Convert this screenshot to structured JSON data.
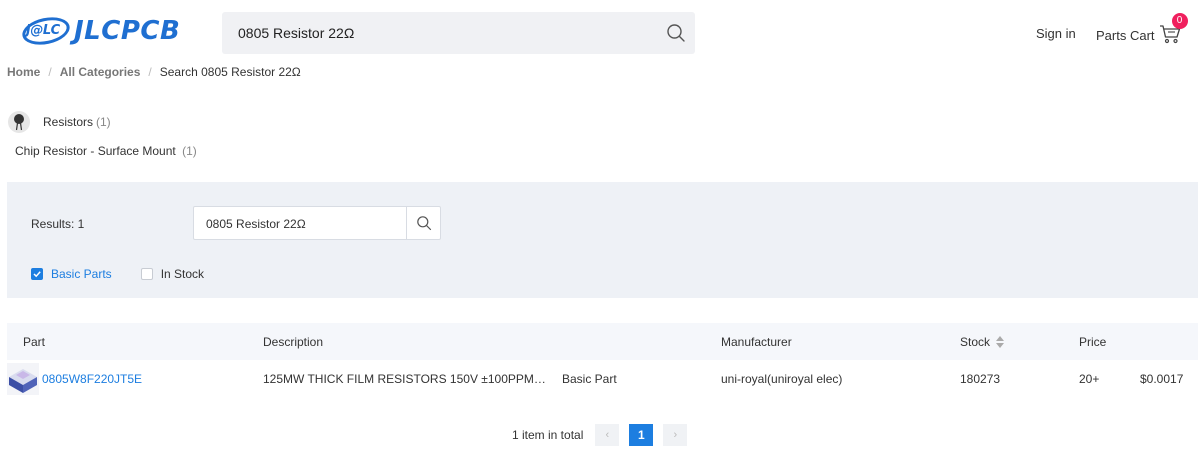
{
  "header": {
    "logo_badge": "J@LC",
    "logo_text": "JLCPCB",
    "search_value": "0805 Resistor 22Ω",
    "sign_in": "Sign in",
    "cart_label": "Parts Cart",
    "cart_count": "0"
  },
  "breadcrumb": {
    "home": "Home",
    "all_categories": "All Categories",
    "current": "Search 0805 Resistor 22Ω"
  },
  "categories": {
    "parent_name": "Resistors",
    "parent_count": "(1)",
    "child_name": "Chip Resistor - Surface Mount",
    "child_count": "(1)"
  },
  "filter": {
    "results_label": "Results: 1",
    "search_value": "0805 Resistor 22Ω",
    "basic_parts_label": "Basic Parts",
    "basic_parts_checked": true,
    "in_stock_label": "In Stock",
    "in_stock_checked": false
  },
  "table": {
    "headers": {
      "part": "Part",
      "description": "Description",
      "manufacturer": "Manufacturer",
      "stock": "Stock",
      "price": "Price"
    },
    "rows": [
      {
        "part_number": "0805W8F220JT5E",
        "description": "125MW THICK FILM RESISTORS 150V ±100PPM…",
        "part_type": "Basic Part",
        "manufacturer": "uni-royal(uniroyal elec)",
        "stock": "180273",
        "price_qty": "20+",
        "price_value": "$0.0017"
      }
    ]
  },
  "pagination": {
    "total": "1 item in total",
    "prev": "‹",
    "current": "1",
    "next": "›"
  },
  "colors": {
    "brand": "#1f6fd1",
    "accent": "#1d7ee0",
    "badge": "#f0205e",
    "panel_bg": "#eef1f6"
  }
}
